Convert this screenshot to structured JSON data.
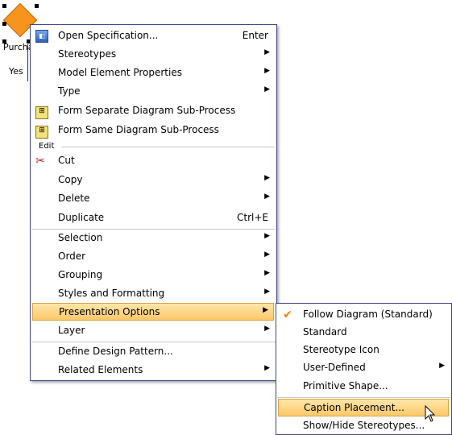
{
  "canvas": {
    "shape_caption": "Purcha",
    "branch_label": "Yes"
  },
  "menu": {
    "group_edit_label": "Edit",
    "items": [
      {
        "label": "Open Specification...",
        "shortcut": "Enter",
        "icon": "specification-icon"
      },
      {
        "label": "Stereotypes",
        "submenu": true
      },
      {
        "label": "Model Element Properties",
        "submenu": true
      },
      {
        "label": "Type",
        "submenu": true
      },
      {
        "label": "Form Separate Diagram Sub-Process",
        "icon": "form-subprocess-icon"
      },
      {
        "label": "Form Same Diagram Sub-Process",
        "icon": "form-subprocess-icon"
      },
      {
        "label": "Cut",
        "icon": "scissors-icon"
      },
      {
        "label": "Copy",
        "submenu": true
      },
      {
        "label": "Delete",
        "submenu": true
      },
      {
        "label": "Duplicate",
        "shortcut": "Ctrl+E"
      },
      {
        "label": "Selection",
        "submenu": true
      },
      {
        "label": "Order",
        "submenu": true
      },
      {
        "label": "Grouping",
        "submenu": true
      },
      {
        "label": "Styles and Formatting",
        "submenu": true
      },
      {
        "label": "Presentation Options",
        "submenu": true,
        "highlighted": true
      },
      {
        "label": "Layer",
        "submenu": true
      },
      {
        "label": "Define Design Pattern..."
      },
      {
        "label": "Related Elements",
        "submenu": true
      }
    ]
  },
  "submenu": {
    "items": [
      {
        "label": "Follow Diagram (Standard)",
        "checked": true
      },
      {
        "label": "Standard"
      },
      {
        "label": "Stereotype Icon"
      },
      {
        "label": "User-Defined",
        "submenu": true
      },
      {
        "label": "Primitive Shape..."
      },
      {
        "label": "Caption Placement...",
        "highlighted": true
      },
      {
        "label": "Show/Hide Stereotypes..."
      }
    ]
  },
  "colors": {
    "highlight": "#fcc86a",
    "menu_border": "#404a88",
    "shape_fill": "#f7941d"
  }
}
